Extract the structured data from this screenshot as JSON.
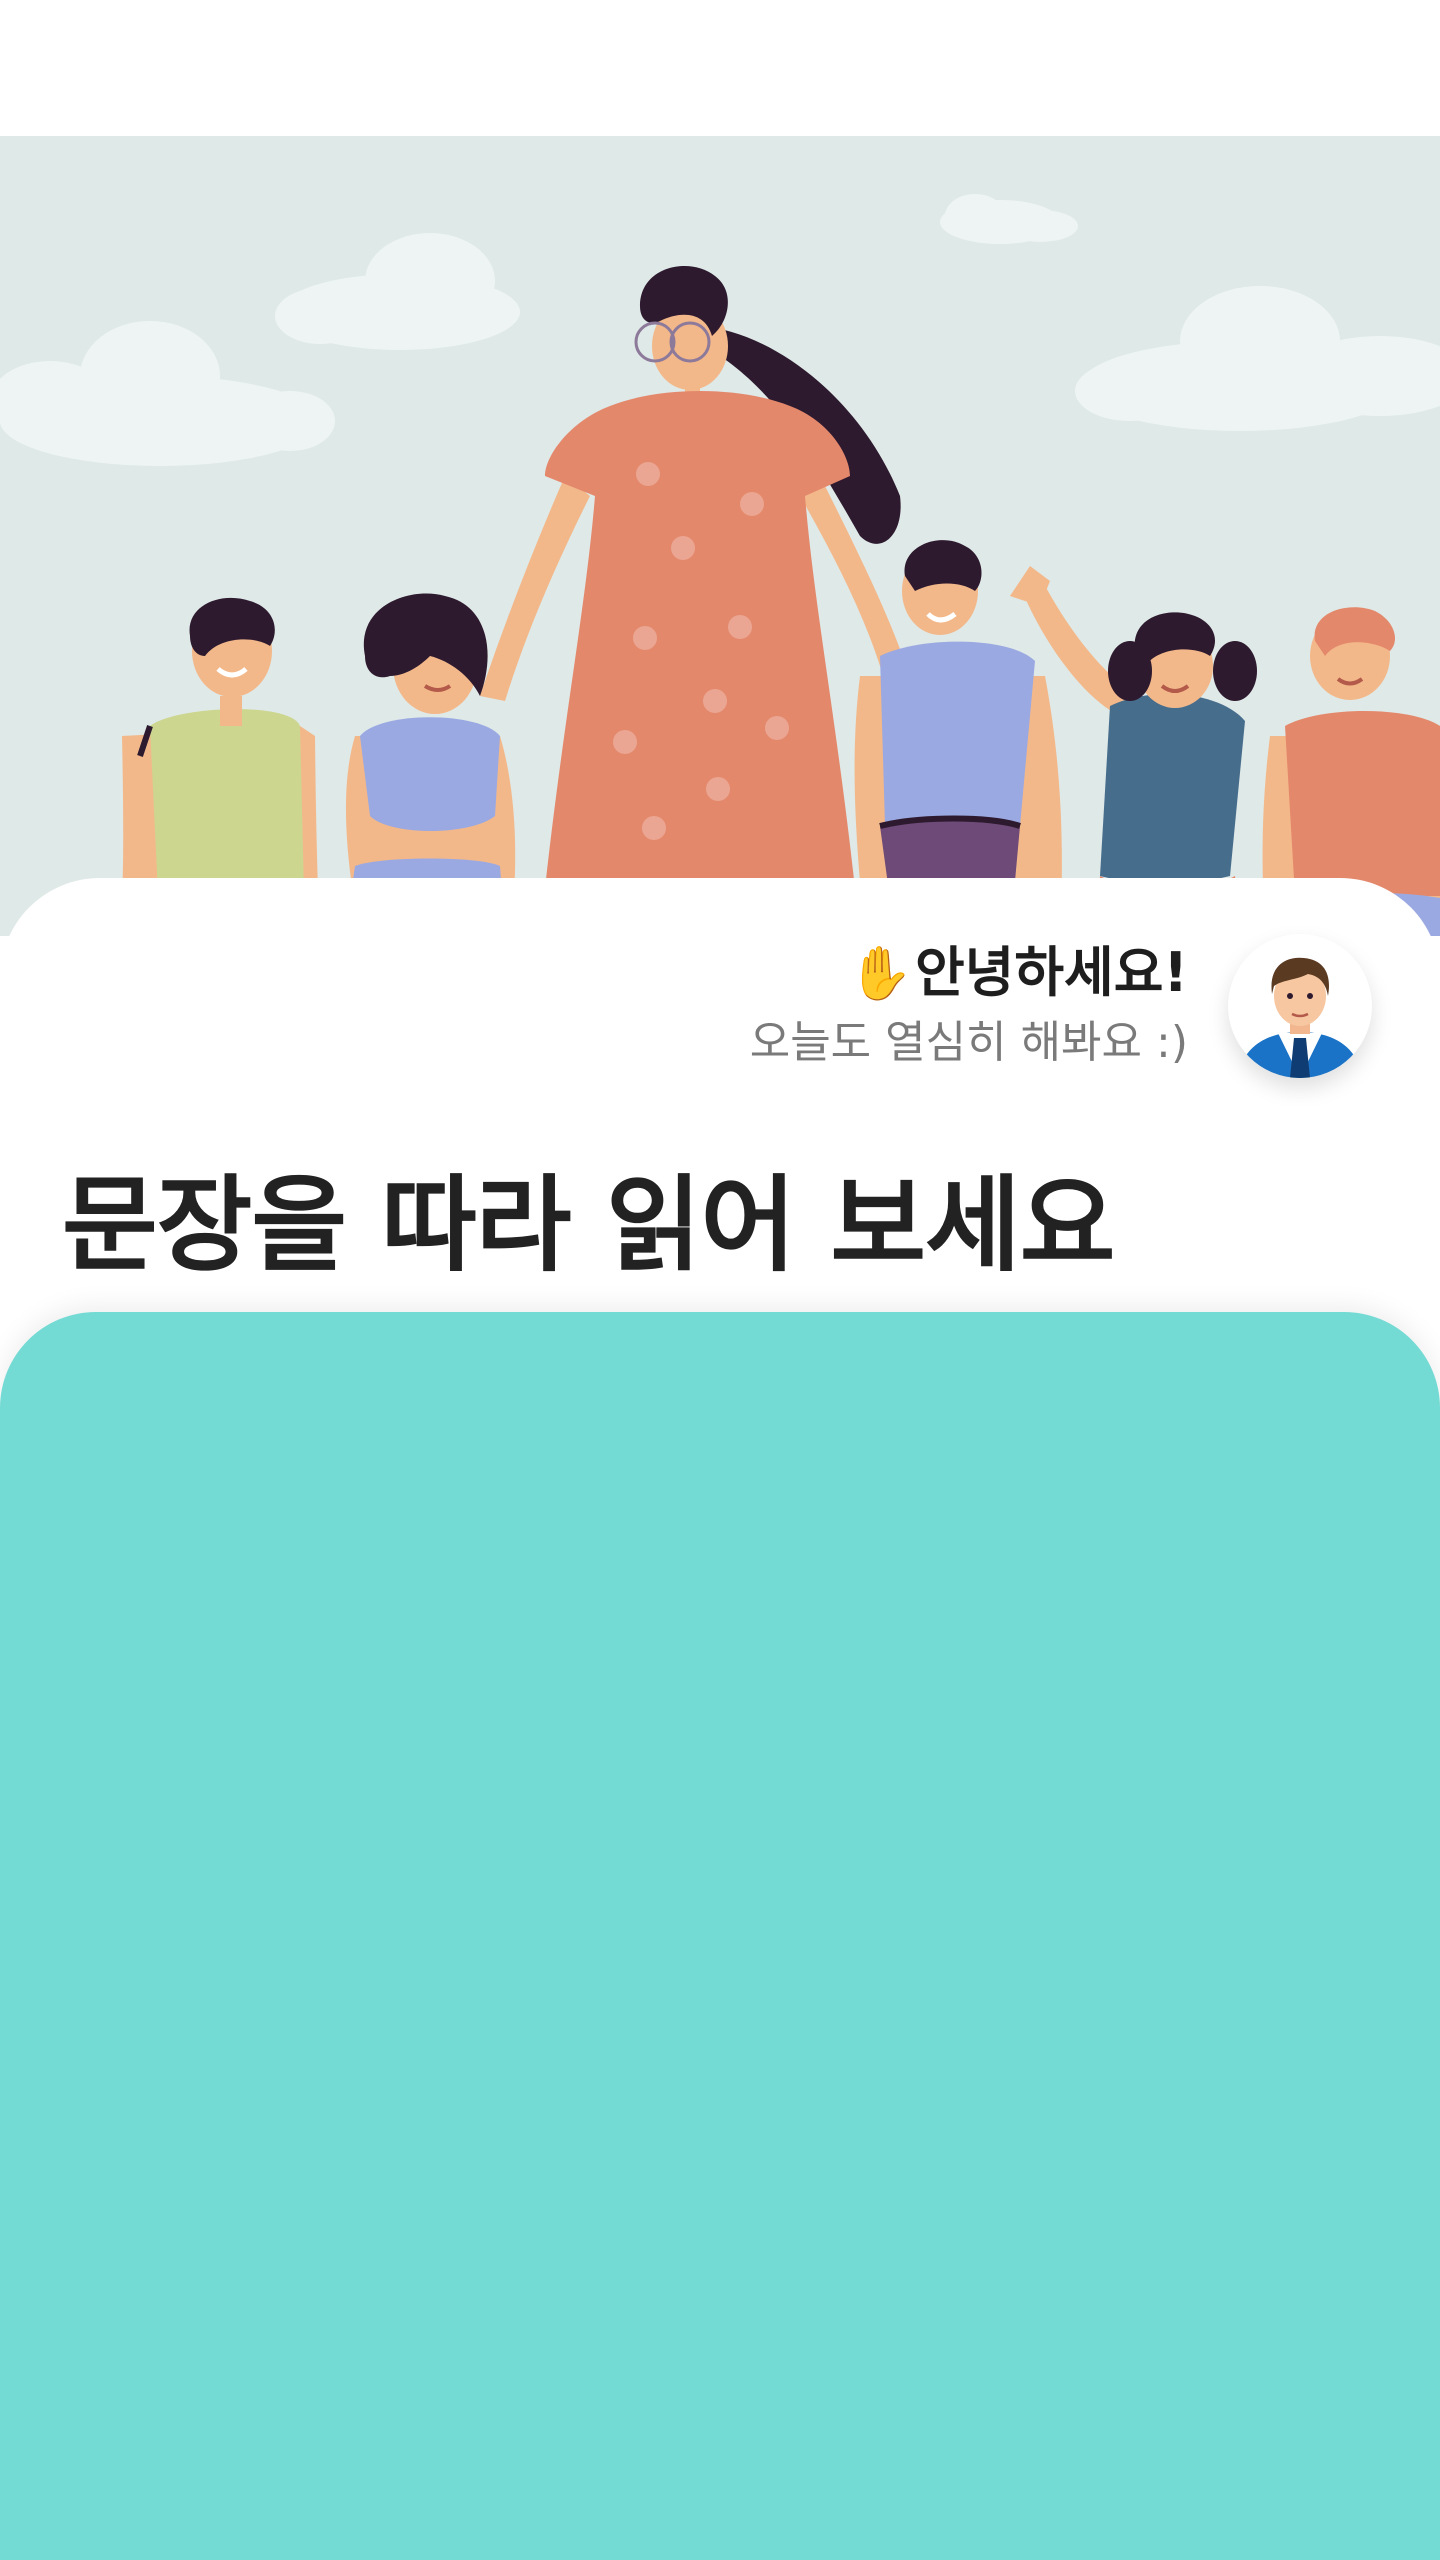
{
  "colors": {
    "status_bar": "#ffffff",
    "hero_background": "#dfe9e7",
    "card_background": "#ffffff",
    "panel_background": "#74dad4",
    "title_text": "#222222",
    "subtitle_text": "#7a7a7a"
  },
  "hero": {
    "illustration": "teacher-with-children-illustration"
  },
  "greeting": {
    "icon": "raised-hand-icon",
    "wave": "✋",
    "title": "안녕하세요!",
    "subtitle": "오늘도 열심히 해봐요 :)"
  },
  "avatar": {
    "icon": "businessman-avatar-icon"
  },
  "instruction": {
    "title": "문장을 따라 읽어 보세요"
  }
}
